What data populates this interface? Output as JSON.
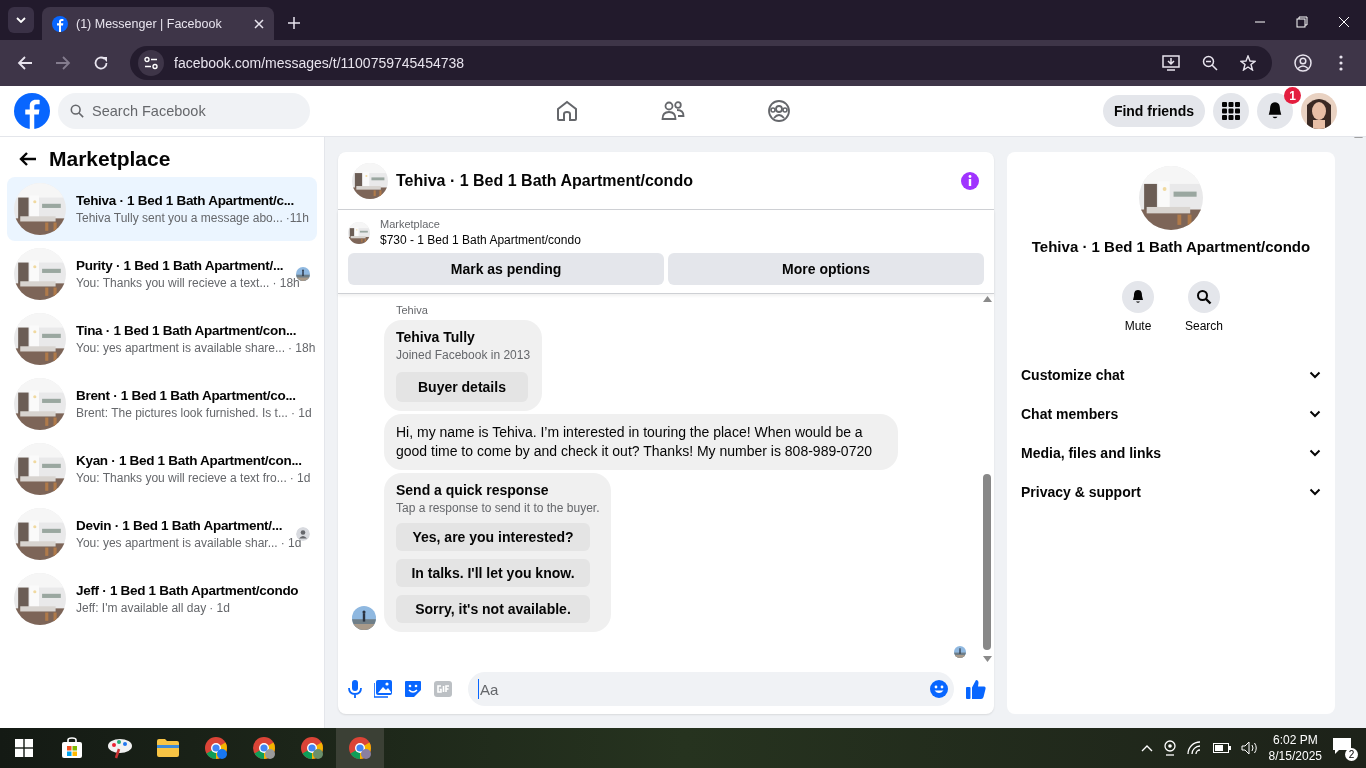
{
  "browser": {
    "tab_title": "(1) Messenger | Facebook",
    "url": "facebook.com/messages/t/1100759745454738"
  },
  "header": {
    "search_placeholder": "Search Facebook",
    "find_friends": "Find friends",
    "notification_count": "1"
  },
  "sidebar": {
    "title": "Marketplace",
    "conversations": [
      {
        "title": "Tehiva · 1 Bed 1 Bath Apartment/c...",
        "preview": "Tehiva Tully sent you a message abo...",
        "time": "·11h",
        "selected": true,
        "kind": "plain"
      },
      {
        "title": "Purity · 1 Bed 1 Bath Apartment/...",
        "preview": "You: Thanks you will recieve a text...",
        "time": "· 18h",
        "selected": false,
        "kind": "seen_photo"
      },
      {
        "title": "Tina · 1 Bed 1 Bath Apartment/con...",
        "preview": "You: yes apartment is available share...",
        "time": "· 18h",
        "selected": false,
        "kind": "plain"
      },
      {
        "title": "Brent · 1 Bed 1 Bath Apartment/co...",
        "preview": "Brent: The pictures look furnished. Is t...",
        "time": "· 1d",
        "selected": false,
        "kind": "plain"
      },
      {
        "title": "Kyan · 1 Bed 1 Bath Apartment/con...",
        "preview": "You: Thanks you will recieve a text fro...",
        "time": "· 1d",
        "selected": false,
        "kind": "plain"
      },
      {
        "title": "Devin · 1 Bed 1 Bath Apartment/...",
        "preview": "You: yes apartment is available shar...",
        "time": "· 1d",
        "selected": false,
        "kind": "seen_person"
      },
      {
        "title": "Jeff · 1 Bed 1 Bath Apartment/condo",
        "preview": "Jeff: I'm available all day",
        "time": "· 1d",
        "selected": false,
        "kind": "plain"
      }
    ]
  },
  "chat": {
    "title": "Tehiva · 1 Bed 1 Bath Apartment/condo",
    "listing_label": "Marketplace",
    "listing": "$730 - 1 Bed 1 Bath Apartment/condo",
    "actions": [
      "Mark as pending",
      "More options"
    ],
    "sender": "Tehiva",
    "buyer": {
      "name": "Tehiva Tully",
      "joined": "Joined Facebook in 2013",
      "button": "Buyer details"
    },
    "message": "Hi, my name is Tehiva. I’m interested in touring the place! When would be a good time to come by and check it out? Thanks! My number is 808-989-0720",
    "quick": {
      "title": "Send a quick response",
      "subtitle": "Tap a response to send it to the buyer.",
      "options": [
        "Yes, are you interested?",
        "In talks. I'll let you know.",
        "Sorry, it's not available."
      ]
    },
    "composer_placeholder": "Aa"
  },
  "details": {
    "title": "Tehiva · 1 Bed 1 Bath Apartment/condo",
    "actions": [
      {
        "kind": "mute",
        "label": "Mute"
      },
      {
        "kind": "search",
        "label": "Search"
      }
    ],
    "sections": [
      "Customize chat",
      "Chat members",
      "Media, files and links",
      "Privacy & support"
    ]
  },
  "taskbar": {
    "time": "6:02 PM",
    "date": "8/15/2025",
    "notifications": "2"
  }
}
